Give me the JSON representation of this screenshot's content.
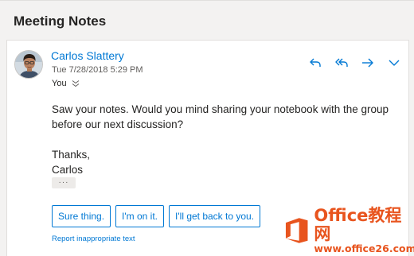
{
  "subject": "Meeting Notes",
  "message": {
    "sender": "Carlos Slattery",
    "date": "Tue 7/28/2018 5:29 PM",
    "to": "You",
    "body": [
      "Saw your notes. Would you mind sharing your notebook with the group",
      "before our next discussion?",
      "Thanks,",
      "Carlos"
    ],
    "more_label": "···"
  },
  "actions": [
    {
      "icon": "reply-icon"
    },
    {
      "icon": "reply-all-icon"
    },
    {
      "icon": "forward-icon"
    },
    {
      "icon": "chevron-down-icon"
    }
  ],
  "suggested_replies": [
    "Sure thing.",
    "I'm on it.",
    "I'll get back to you."
  ],
  "report_link": "Report inappropriate text",
  "watermark": {
    "title": "Office教程网",
    "url": "www.office26.com"
  },
  "colors": {
    "accent": "#0078d4",
    "watermark": "#e8541e"
  }
}
